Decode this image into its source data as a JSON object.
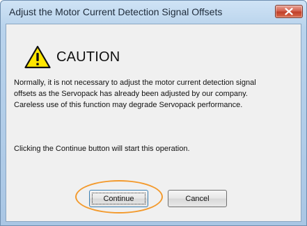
{
  "window": {
    "title": "Adjust the Motor Current Detection Signal Offsets",
    "close_icon": "close-icon"
  },
  "caution": {
    "icon": "warning-triangle-icon",
    "heading": "CAUTION"
  },
  "messages": {
    "line1": "Normally, it is not necessary to adjust the motor current detection signal",
    "line2": "offsets as the Servopack has already been adjusted by our company.",
    "line3": "Careless use of this function may degrade Servopack performance.",
    "instruction": "Clicking the Continue button will start this operation."
  },
  "buttons": {
    "continue_label": "Continue",
    "cancel_label": "Cancel"
  },
  "colors": {
    "highlight_ring": "#f39a2d",
    "warning_fill": "#ffe600",
    "close_button": "#c0402a"
  }
}
